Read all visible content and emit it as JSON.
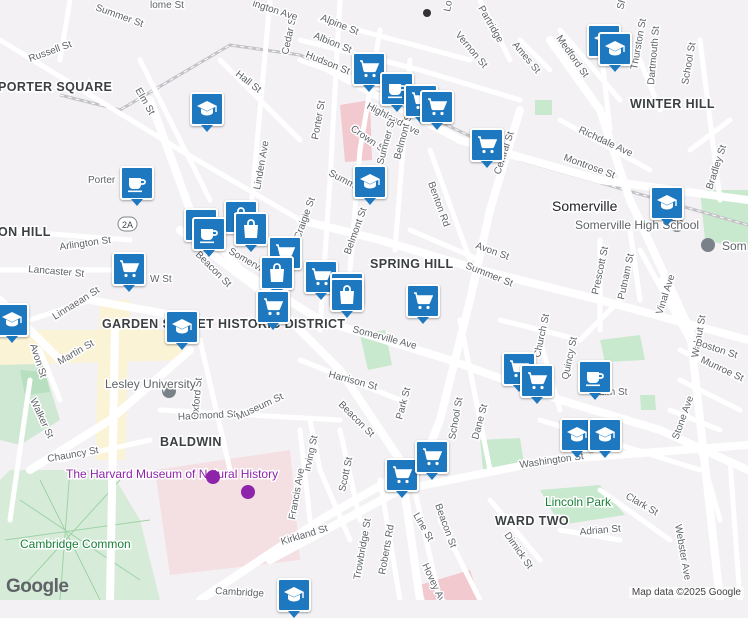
{
  "map": {
    "areas": [
      "PORTER SQUARE",
      "WINTER HILL",
      "SPRING HILL",
      "BALDWIN",
      "WARD TWO",
      "ON HILL",
      "GARDEN STREET HISTORIC DISTRICT"
    ],
    "city": "Somerville",
    "pois": {
      "high_school": "Somerville High School",
      "somerville_partial": "Som",
      "museum": "The Harvard Museum of Natural History",
      "lesley": "Lesley University",
      "lincoln_park": "Lincoln Park",
      "cambridge_common": "Cambridge Common"
    },
    "streets": {
      "summer_top": "Summer St",
      "russell": "Russell St",
      "hall": "Hall St",
      "elm": "Elm St",
      "cedar": "Cedar St",
      "alpine": "Alpine St",
      "albion": "Albion St",
      "hudson": "Hudson St",
      "highland": "Highland Ave",
      "porter_st": "Porter St",
      "crown": "Crown St",
      "linden": "Linden Ave",
      "benton": "Benton Rd",
      "central": "Central St",
      "richdale": "Richdale Ave",
      "montrose": "Montrose St",
      "bradley": "Bradley St",
      "medford": "Medford St",
      "vernon": "Vernon St",
      "ames": "Ames St",
      "partridge": "Partridge",
      "dartmouth": "Dartmouth St",
      "thurston": "Thurston St",
      "school": "School St",
      "summer_mid": "Summer St",
      "craigie": "Craigie St",
      "belmont": "Belmont St",
      "avon": "Avon St",
      "summer_east": "Summer St",
      "prescott": "Prescott St",
      "putnam": "Putnam St",
      "vinal": "Vinal Ave",
      "walnut": "Walnut St",
      "porter_label": "Porter",
      "arlington": "Arlington St",
      "lancaster": "Lancaster St",
      "beacon_w": "Beacon St",
      "somerville_ave_w": "Somerville",
      "somerville_ave": "Somerville Ave",
      "linnaean": "Linnaean St",
      "martin": "Martin St",
      "avon_w": "Avon St",
      "walker": "Walker St",
      "chauncy": "Chauncy St",
      "hammond": "Hammond St",
      "museum_st": "Museum St",
      "oxford": "Oxford St",
      "harrison": "Harrison St",
      "beacon_mid": "Beacon St",
      "park": "Park St",
      "irving": "Irving St",
      "francis": "Francis Ave",
      "scott": "Scott St",
      "dane": "Dane St",
      "washington": "Washington St",
      "kirkland": "Kirkland St",
      "trowbridge": "Trowbridge St",
      "roberts": "Roberts Rd",
      "line": "Line St",
      "beacon_s": "Beacon St",
      "hovey": "Hovey Ave",
      "dimick": "Dimick St",
      "adrian": "Adrian St",
      "clark": "Clark St",
      "webster": "Webster Ave",
      "stone": "Stone Ave",
      "boston": "Boston St",
      "munroe": "Munroe St",
      "cambridge": "Cambridge",
      "route": "2A",
      "church": "Church St",
      "quincy": "Quincy St",
      "school_s": "School St",
      "elm_e": "Elm St",
      "w_st": "W St",
      "lo": "Lo",
      "ington": "ington Ave",
      "holme": "lome St",
      "sherman": "Sherman",
      "sumner_w": "Sumner St"
    }
  },
  "markers": [
    {
      "type": "grocery"
    },
    {
      "type": "coffee"
    },
    {
      "type": "grocery"
    },
    {
      "type": "grocery"
    },
    {
      "type": "school"
    },
    {
      "type": "grocery"
    },
    {
      "type": "school"
    },
    {
      "type": "school"
    },
    {
      "type": "school"
    },
    {
      "type": "coffee"
    },
    {
      "type": "grocery"
    },
    {
      "type": "coffee"
    },
    {
      "type": "shopping"
    },
    {
      "type": "shopping"
    },
    {
      "type": "coffee"
    },
    {
      "type": "grocery"
    },
    {
      "type": "shopping"
    },
    {
      "type": "grocery"
    },
    {
      "type": "school"
    },
    {
      "type": "shopping"
    },
    {
      "type": "grocery"
    },
    {
      "type": "school"
    },
    {
      "type": "shopping"
    },
    {
      "type": "school"
    },
    {
      "type": "grocery"
    },
    {
      "type": "grocery"
    },
    {
      "type": "coffee"
    },
    {
      "type": "grocery"
    },
    {
      "type": "school"
    },
    {
      "type": "school"
    },
    {
      "type": "grocery"
    },
    {
      "type": "grocery"
    },
    {
      "type": "school"
    }
  ],
  "logo": "Google",
  "attribution": "Map data ©2025 Google"
}
